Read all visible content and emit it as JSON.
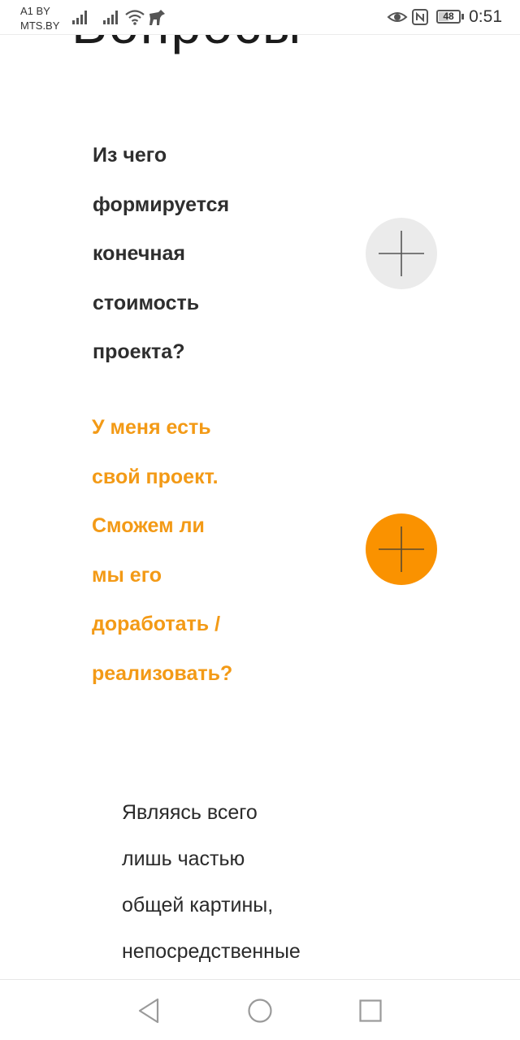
{
  "status_bar": {
    "carrier_1": "A1 BY",
    "carrier_2": "MTS.BY",
    "battery_level": "48",
    "time": "0:51",
    "icons": [
      "signal-icon",
      "signal-icon",
      "wifi-icon",
      "pet-notification-icon",
      "eye-comfort-icon",
      "nfc-icon",
      "battery-icon"
    ]
  },
  "page": {
    "heading_partial": "Вопросы"
  },
  "faq": [
    {
      "question": "Из чего\nформируется\nконечная\nстоимость\nпроекта?",
      "state": "collapsed",
      "toggle_icon": "plus-icon",
      "toggle_color": "#ebebeb",
      "text_color": "#2e2e2e"
    },
    {
      "question": "У меня есть\nсвой проект.\nСможем ли\nмы его\nдоработать /\nреализовать?",
      "state": "active",
      "toggle_icon": "plus-icon",
      "toggle_color": "#fa9200",
      "text_color": "#f39a16"
    }
  ],
  "answer": {
    "text": "Являясь всего\nлишь частью\nобщей картины,\nнепосредственные"
  },
  "nav_bar": {
    "icons": [
      "back-icon",
      "home-icon",
      "recents-icon"
    ]
  }
}
